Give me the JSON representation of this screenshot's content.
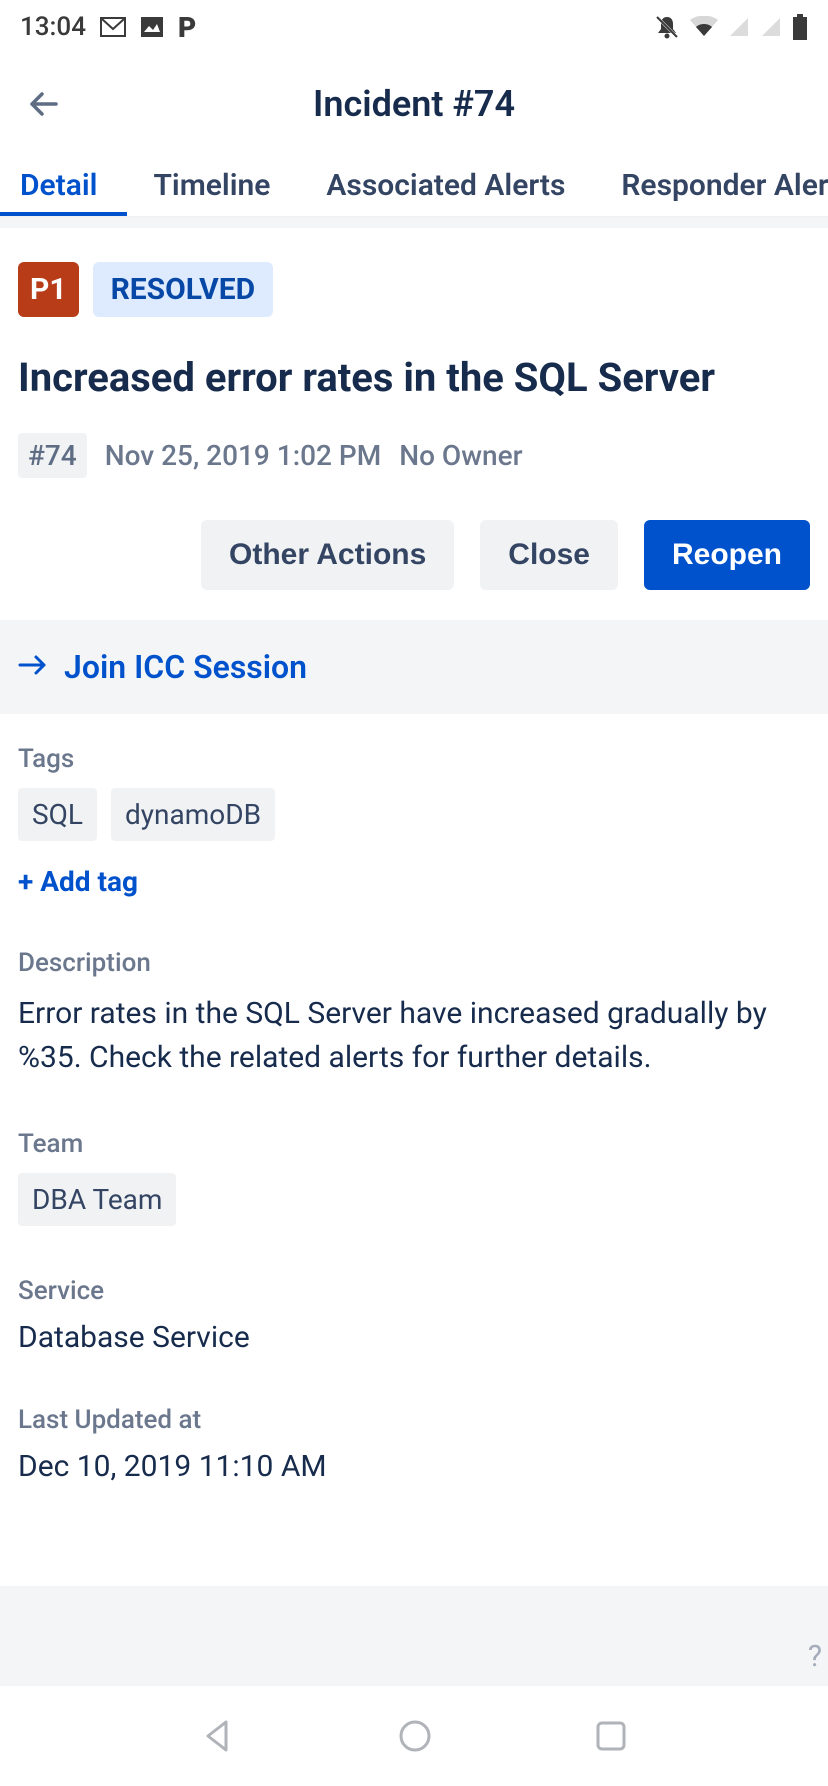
{
  "status_bar": {
    "time": "13:04"
  },
  "header": {
    "title": "Incident #74"
  },
  "tabs": {
    "detail": "Detail",
    "timeline": "Timeline",
    "associated": "Associated Alerts",
    "responder": "Responder Alerts"
  },
  "incident": {
    "priority": "P1",
    "status": "RESOLVED",
    "title": "Increased error rates in the SQL Server",
    "id_chip": "#74",
    "created": "Nov 25, 2019 1:02 PM",
    "owner": "No Owner"
  },
  "actions": {
    "other": "Other Actions",
    "close": "Close",
    "reopen": "Reopen"
  },
  "icc": {
    "label": "Join ICC Session"
  },
  "tags": {
    "label": "Tags",
    "items": [
      "SQL",
      "dynamoDB"
    ],
    "add": "+ Add tag"
  },
  "description": {
    "label": "Description",
    "text": "Error rates in the SQL Server have increased gradually by %35. Check the related alerts for further details."
  },
  "team": {
    "label": "Team",
    "value": "DBA Team"
  },
  "service": {
    "label": "Service",
    "value": "Database Service"
  },
  "updated": {
    "label": "Last Updated at",
    "value": "Dec 10, 2019 11:10 AM"
  }
}
